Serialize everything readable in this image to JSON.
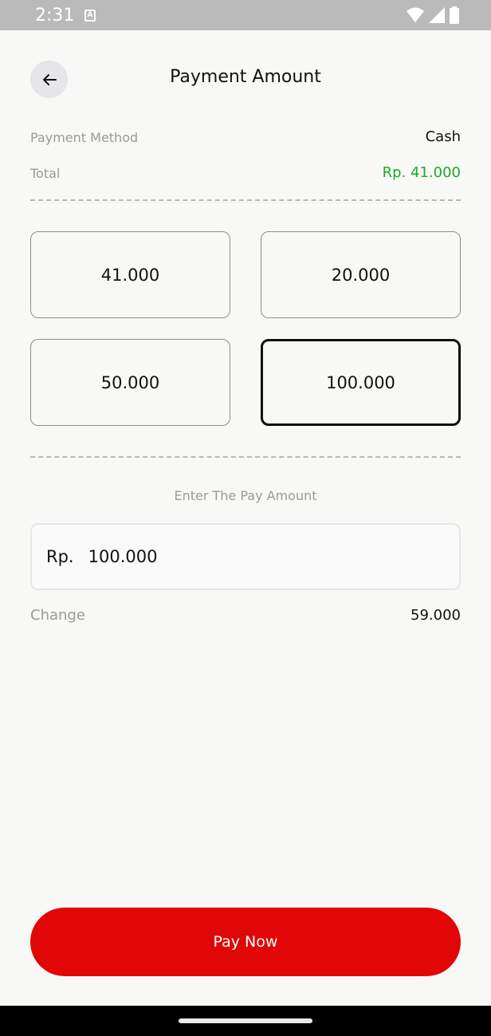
{
  "status_bar": {
    "time": "2:31"
  },
  "header": {
    "title": "Payment Amount"
  },
  "payment_method": {
    "label": "Payment Method",
    "value": "Cash"
  },
  "total": {
    "label": "Total",
    "value": "Rp. 41.000"
  },
  "quick_amounts": [
    {
      "label": "41.000",
      "selected": false
    },
    {
      "label": "20.000",
      "selected": false
    },
    {
      "label": "50.000",
      "selected": false
    },
    {
      "label": "100.000",
      "selected": true
    }
  ],
  "pay_amount": {
    "label": "Enter The Pay Amount",
    "prefix": "Rp.",
    "value": "100.000"
  },
  "change": {
    "label": "Change",
    "value": "59.000"
  },
  "pay_button": {
    "label": "Pay Now"
  },
  "colors": {
    "accent_red": "#e10707",
    "total_green": "#1fa82e",
    "background": "#f8f8f6"
  }
}
